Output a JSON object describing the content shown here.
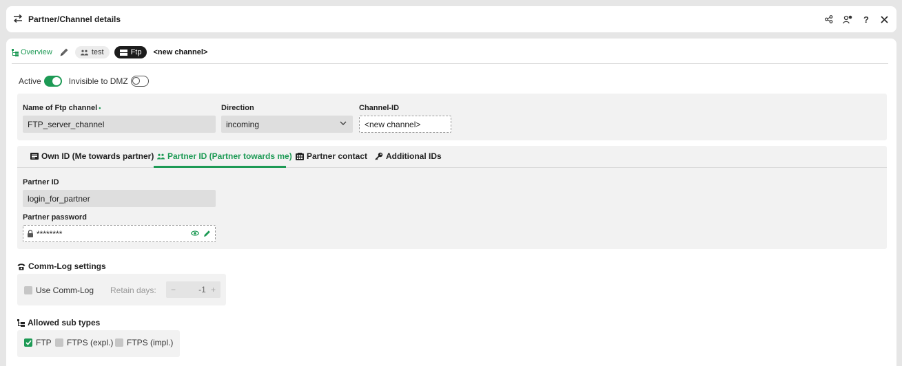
{
  "window": {
    "title": "Partner/Channel details",
    "icons": [
      "swap-icon",
      "share-icon",
      "user-settings-icon",
      "help-icon",
      "close-icon"
    ]
  },
  "breadcrumb": {
    "overview": "Overview",
    "partner_chip": "test",
    "type_chip": "Ftp",
    "current": "<new channel>"
  },
  "toggles": {
    "active_label": "Active",
    "active_on": true,
    "dmz_label": "Invisible to DMZ",
    "dmz_on": false
  },
  "channel": {
    "name_label": "Name of Ftp channel",
    "required_mark": "•",
    "name_value": "FTP_server_channel",
    "direction_label": "Direction",
    "direction_value": "incoming",
    "id_label": "Channel-ID",
    "id_value": "<new channel>"
  },
  "tabs": [
    {
      "label": "Own ID (Me towards partner)",
      "icon": "id-card-icon",
      "active": false
    },
    {
      "label": "Partner ID (Partner towards me)",
      "icon": "partner-icon",
      "active": true
    },
    {
      "label": "Partner contact",
      "icon": "phone-book-icon",
      "active": false
    },
    {
      "label": "Additional IDs",
      "icon": "key-icon",
      "active": false
    }
  ],
  "partner": {
    "id_label": "Partner ID",
    "id_value": "login_for_partner",
    "password_label": "Partner password",
    "password_value": "********"
  },
  "commlog": {
    "title": "Comm-Log settings",
    "use_label": "Use Comm-Log",
    "use_checked": false,
    "retain_label": "Retain days:",
    "retain_value": "-1",
    "minus": "−",
    "plus": "+"
  },
  "subtypes": {
    "title": "Allowed sub types",
    "items": [
      {
        "label": "FTP",
        "checked": true
      },
      {
        "label": "FTPS (expl.)",
        "checked": false
      },
      {
        "label": "FTPS (impl.)",
        "checked": false
      }
    ]
  },
  "colors": {
    "accent": "#1d9a55",
    "panel": "#f2f2f2",
    "field": "#dedede"
  }
}
